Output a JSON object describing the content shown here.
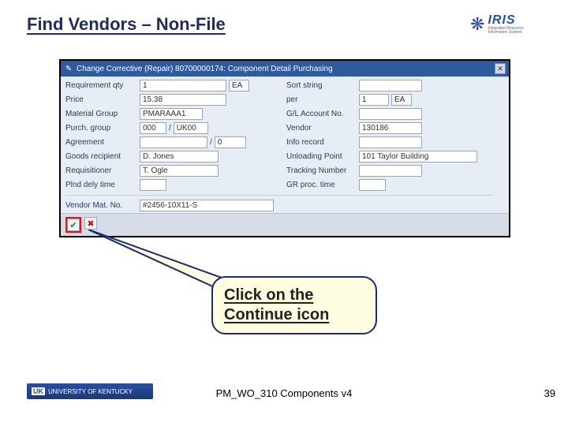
{
  "title": "Find Vendors – Non-File",
  "logo": {
    "brand": "IRIS",
    "tagline": "Integrated Resource Information System"
  },
  "window": {
    "title": "Change Corrective (Repair) 80700000174: Component Detail Purchasing",
    "fields": {
      "req_qty_label": "Requirement qty",
      "req_qty_value": "1",
      "req_qty_unit": "EA",
      "sort_label": "Sort string",
      "sort_value": "",
      "price_label": "Price",
      "price_value": "15.38",
      "per_label": "per",
      "per_value": "1",
      "per_unit": "EA",
      "matgrp_label": "Material Group",
      "matgrp_value": "PMARAAA1",
      "glacct_label": "G/L Account No.",
      "glacct_value": "",
      "pgrp_label": "Purch. group",
      "pgrp_value1": "000",
      "pgrp_sep": "/",
      "pgrp_value2": "UK00",
      "vendor_label": "Vendor",
      "vendor_value": "130186",
      "agree_label": "Agreement",
      "agree_value": "",
      "agree_sep": "/",
      "agree_item": "0",
      "info_label": "Info record",
      "info_value": "",
      "goods_label": "Goods recipient",
      "goods_value": "D. Jones",
      "unload_label": "Unloading Point",
      "unload_value": "101 Taylor Building",
      "reqr_label": "Requisitioner",
      "reqr_value": "T. Ogle",
      "track_label": "Tracking Number",
      "track_value": "",
      "plnd_label": "Plnd dely time",
      "plnd_value": "",
      "grproc_label": "GR proc. time",
      "grproc_value": "",
      "vmat_label": "Vendor Mat. No.",
      "vmat_value": "#2456-10X11-S"
    },
    "icons": {
      "continue": "✔",
      "cancel": "✖",
      "title_icon": "✎",
      "close": "✕"
    }
  },
  "callout": "Click on the Continue icon",
  "footer": {
    "uk_prefix": "UK",
    "uk_text": "UNIVERSITY OF KENTUCKY",
    "center": "PM_WO_310 Components v4",
    "page": "39"
  }
}
